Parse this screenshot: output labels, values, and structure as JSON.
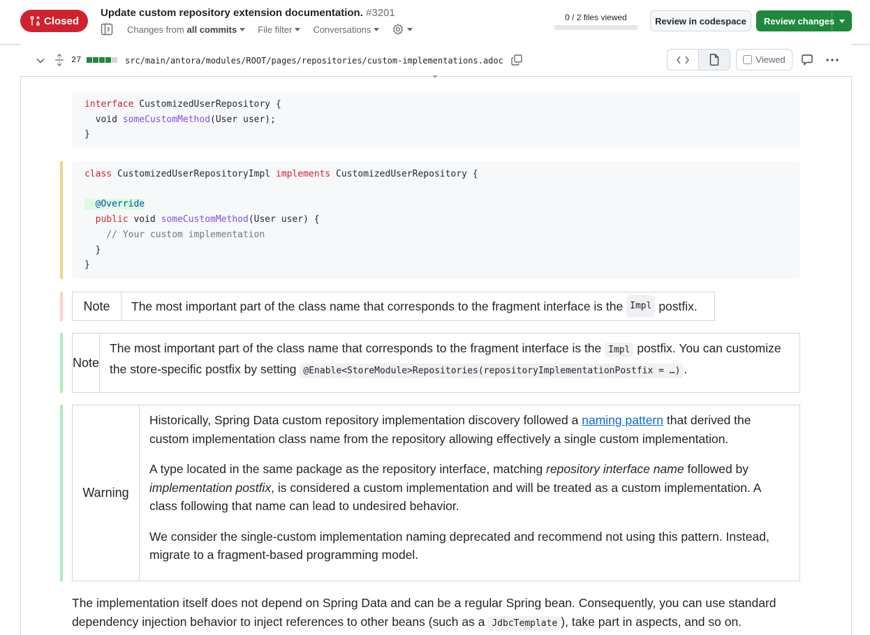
{
  "pr": {
    "state": "Closed",
    "title": "Update custom repository extension documentation.",
    "number": "#3201",
    "files_viewed": "0 / 2 files viewed",
    "files_viewed_fraction": 0.0
  },
  "subnav": {
    "changes_prefix": "Changes from",
    "changes_value": "all commits",
    "file_filter": "File filter",
    "conversations": "Conversations"
  },
  "actions": {
    "codespace": "Review in codespace",
    "review": "Review changes"
  },
  "file": {
    "changes_count": "27",
    "diffstat": [
      "added",
      "added",
      "added",
      "added",
      "neutral"
    ],
    "path": "src/main/antora/modules/ROOT/pages/repositories/custom-implementations.adoc",
    "viewed_label": "Viewed"
  },
  "colors": {
    "closed": "#cf222e",
    "review_green": "#1f883d",
    "bar_yellow": "#eed888",
    "bar_red": "#ffcecb",
    "bar_green": "#aceebb"
  },
  "code1": {
    "l1_kw": "interface",
    "l1_rest": " CustomizedUserRepository {",
    "l2_indent": "  void ",
    "l2_fn": "someCustomMethod",
    "l2_rest": "(User user);",
    "l3": "}"
  },
  "code2": {
    "l1_kw1": "class",
    "l1_mid": " CustomizedUserRepositoryImpl ",
    "l1_kw2": "implements",
    "l1_rest": " CustomizedUserRepository {",
    "l3_ann": "  @Override",
    "l4_kw": "public",
    "l4_mid": " void ",
    "l4_fn": "someCustomMethod",
    "l4_rest": "(User user) {",
    "l5_cm": "// Your custom implementation",
    "l6": "  }",
    "l7": "}"
  },
  "note_old": {
    "label": "Note",
    "text": "The most important part of the class name that corresponds to the fragment interface is the",
    "code": "Impl",
    "suffix": "postfix."
  },
  "note_new": {
    "label": "Note",
    "text1": "The most important part of the class name that corresponds to the fragment interface is the",
    "code1": "Impl",
    "text2": "postfix. You can customize the store-specific postfix by setting",
    "code2": "@Enable<StoreModule>Repositories(repositoryImplementationPostfix = …)",
    "text3": "."
  },
  "warning": {
    "label": "Warning",
    "p1_a": "Historically, Spring Data custom repository implementation discovery followed a",
    "p1_link": "naming pattern",
    "p1_b": "that derived the custom implementation class name from the repository allowing effectively a single custom implementation.",
    "p2_a": "A type located in the same package as the repository interface, matching",
    "p2_em1": "repository interface name",
    "p2_b": "followed by",
    "p2_em2": "implementation postfix",
    "p2_c": ", is considered a custom implementation and will be treated as a custom implementation. A class following that name can lead to undesired behavior.",
    "p3": "We consider the single-custom implementation naming deprecated and recommend not using this pattern. Instead, migrate to a fragment-based programming model."
  },
  "paragraph": {
    "a": "The implementation itself does not depend on Spring Data and can be a regular Spring bean. Consequently, you can use standard dependency injection behavior to inject references to other beans (such as a",
    "code": "JdbcTemplate",
    "b": "), take part in aspects, and so on."
  }
}
